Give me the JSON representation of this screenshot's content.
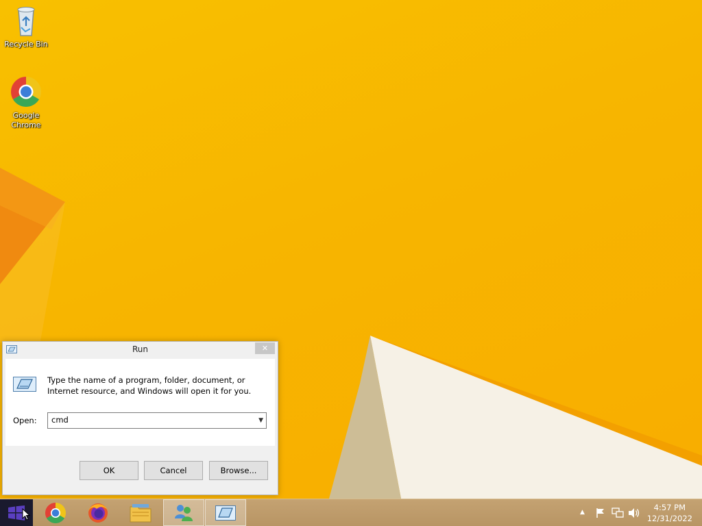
{
  "desktop": {
    "icons": [
      {
        "label": "Recycle Bin",
        "icon": "recycle-bin-icon"
      },
      {
        "label": "Google Chrome",
        "label_lines": [
          "Google",
          "Chrome"
        ],
        "icon": "chrome-icon"
      }
    ]
  },
  "run_dialog": {
    "title": "Run",
    "close_label": "✕",
    "description_line1": "Type the name of a program, folder, document, or",
    "description_line2": "Internet resource, and Windows will open it for you.",
    "open_label": "Open:",
    "open_value": "cmd",
    "buttons": {
      "ok": "OK",
      "cancel": "Cancel",
      "browse": "Browse..."
    }
  },
  "taskbar": {
    "pinned": [
      {
        "name": "Google Chrome",
        "icon": "chrome-icon"
      },
      {
        "name": "Firefox",
        "icon": "firefox-icon"
      },
      {
        "name": "File Explorer",
        "icon": "file-explorer-icon"
      },
      {
        "name": "Network users",
        "icon": "network-users-icon"
      },
      {
        "name": "Run",
        "icon": "run-icon",
        "active": true
      }
    ],
    "tray": {
      "icons": [
        "chevron-up-icon",
        "action-center-flag-icon",
        "network-icon",
        "volume-icon"
      ],
      "time": "4:57 PM",
      "date": "12/31/2022"
    }
  },
  "colors": {
    "wallpaper": "#f8b600",
    "taskbar": "#bd9a69",
    "dialog_bg": "#f0f0f0",
    "button_bg": "#e1e1e1",
    "close_button": "#c7c7c7"
  }
}
